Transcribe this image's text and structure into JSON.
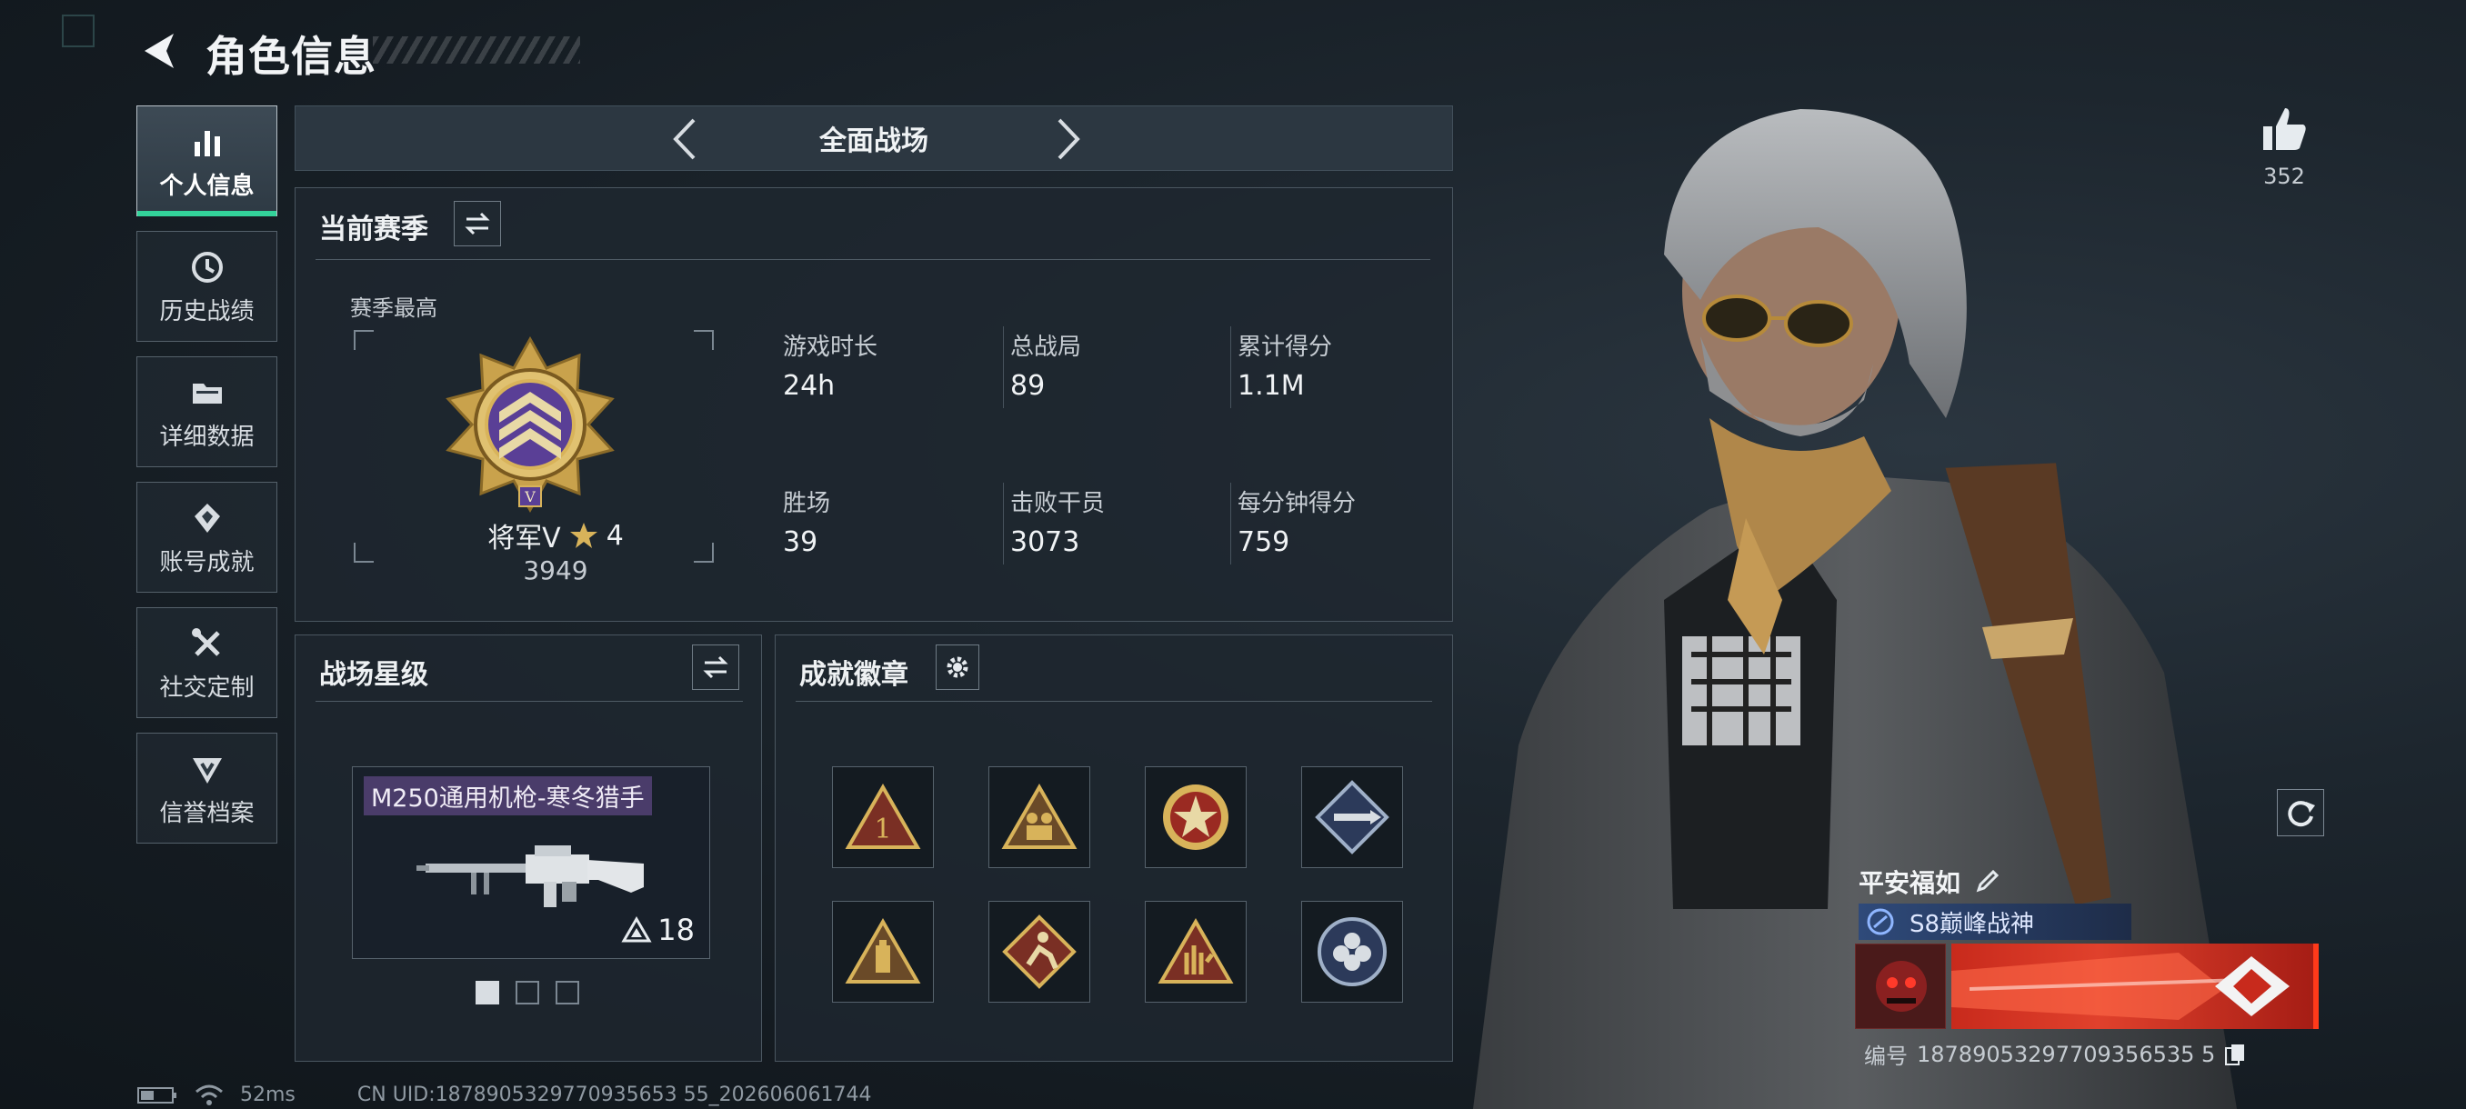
{
  "header": {
    "title": "角色信息"
  },
  "sidebar": {
    "items": [
      {
        "label": "个人信息",
        "icon": "bar-chart-icon",
        "active": true
      },
      {
        "label": "历史战绩",
        "icon": "history-icon"
      },
      {
        "label": "详细数据",
        "icon": "folder-icon"
      },
      {
        "label": "账号成就",
        "icon": "achievement-icon"
      },
      {
        "label": "社交定制",
        "icon": "tools-icon"
      },
      {
        "label": "信誉档案",
        "icon": "credit-icon"
      }
    ]
  },
  "mode": {
    "label": "全面战场"
  },
  "season": {
    "title": "当前赛季",
    "best_label": "赛季最高",
    "rank_name": "将军V",
    "rank_stars": "4",
    "rank_points": "3949",
    "stats": [
      {
        "label": "游戏时长",
        "value": "24h"
      },
      {
        "label": "总战局",
        "value": "89"
      },
      {
        "label": "累计得分",
        "value": "1.1M"
      },
      {
        "label": "胜场",
        "value": "39"
      },
      {
        "label": "击败干员",
        "value": "3073"
      },
      {
        "label": "每分钟得分",
        "value": "759"
      }
    ]
  },
  "star_level": {
    "title": "战场星级",
    "weapon_name": "M250通用机枪-寒冬猎手",
    "weapon_level": "18"
  },
  "achievements": {
    "title": "成就徽章"
  },
  "likes": {
    "count": "352"
  },
  "profile": {
    "name": "平安福如",
    "title_badge": "S8巅峰战神",
    "id_label": "编号",
    "id_value": "18789053297709356535 5"
  },
  "status_bar": {
    "ping": "52ms",
    "uid": "CN UID:1878905329770935653 55_202606061744"
  },
  "colors": {
    "accent_green": "#33d39a",
    "gold": "#d8b35a",
    "rank_purple": "#5a3f96",
    "card_red": "#e0412c"
  }
}
